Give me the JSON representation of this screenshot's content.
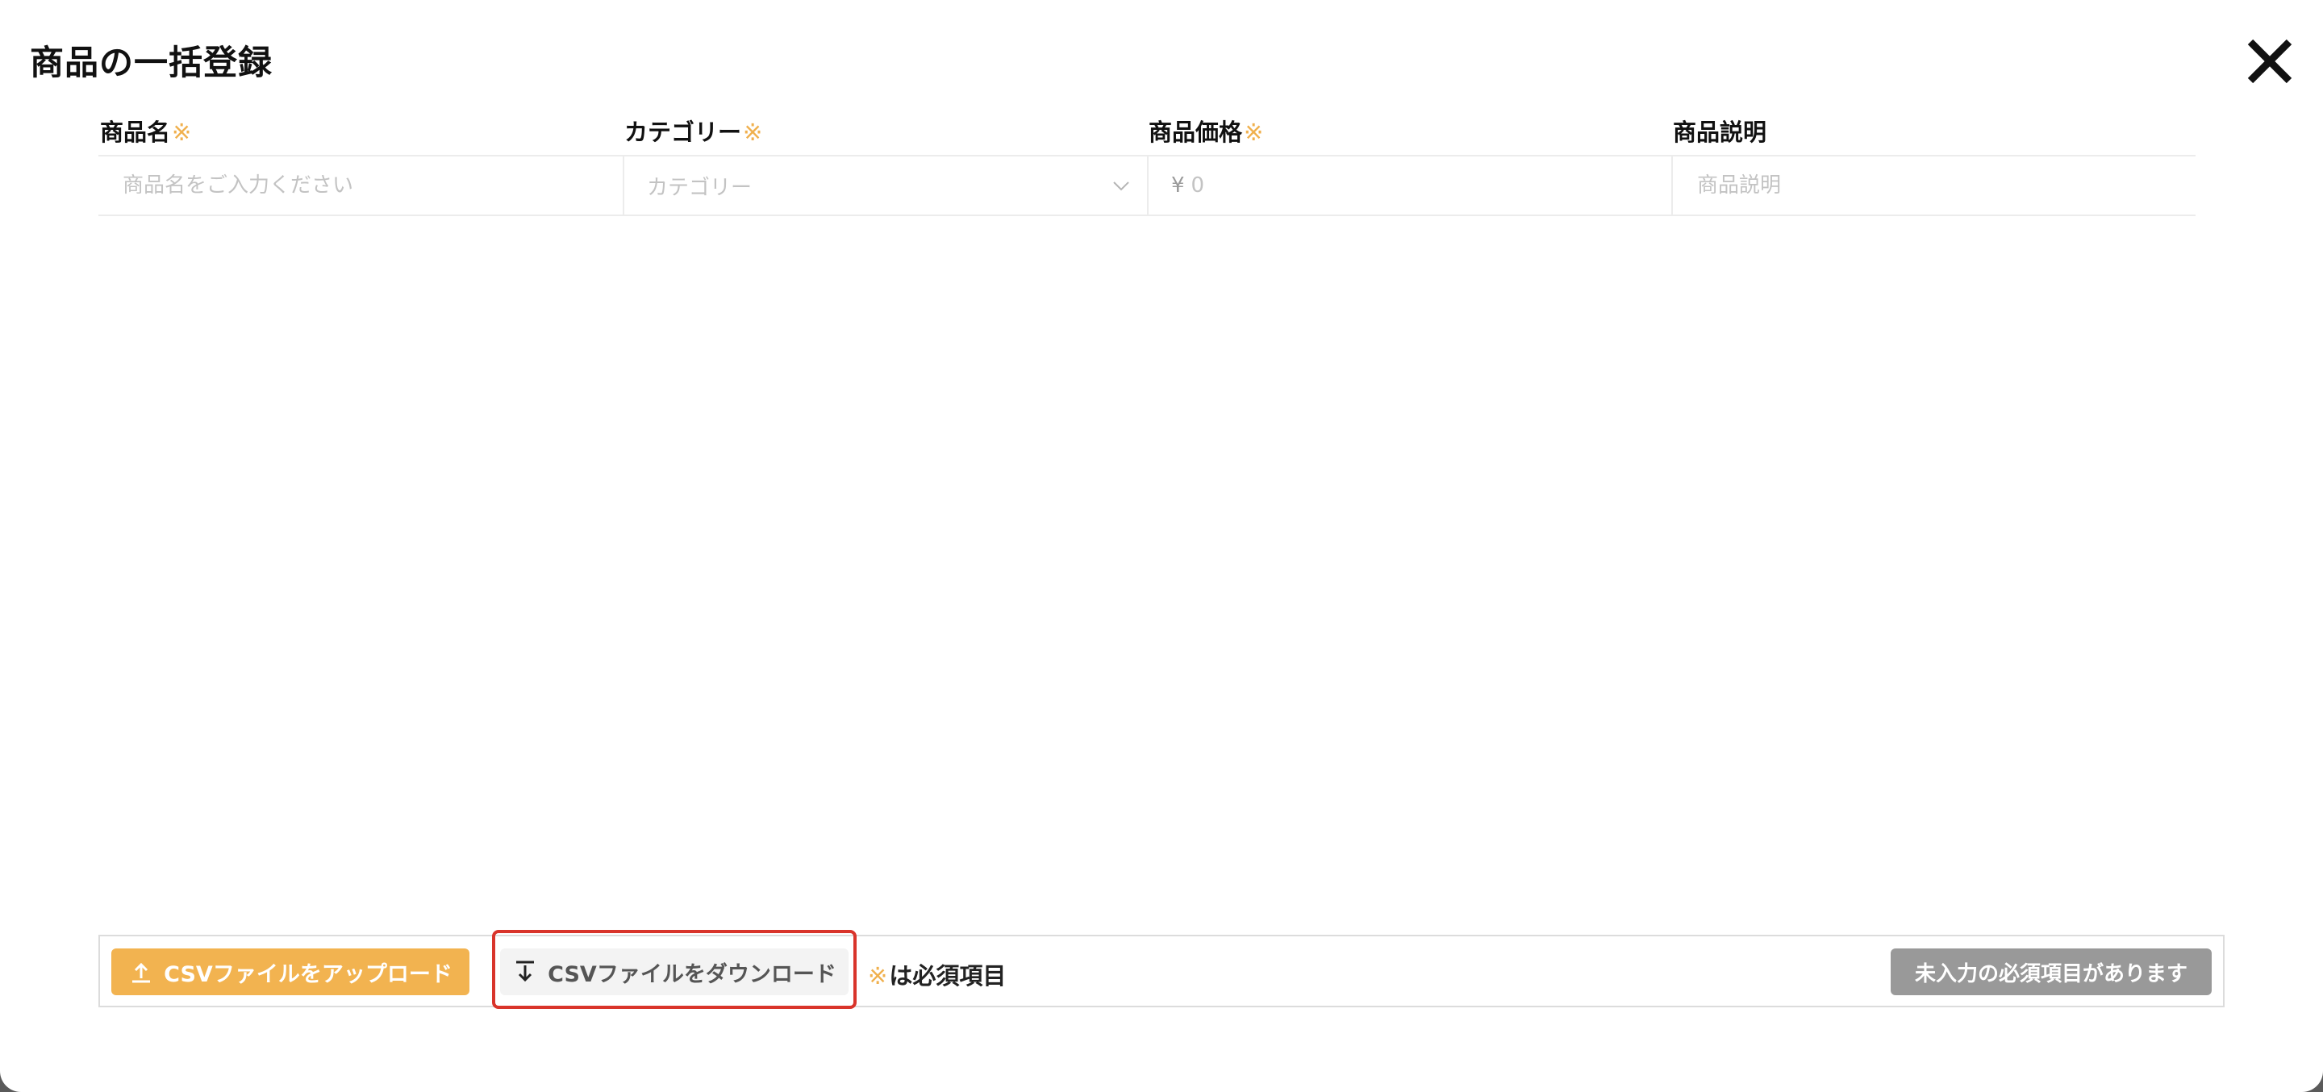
{
  "modal": {
    "title": "商品の一括登録"
  },
  "form": {
    "required_mark": "※",
    "columns": [
      {
        "label": "商品名",
        "required": true,
        "placeholder": "商品名をご入力ください"
      },
      {
        "label": "カテゴリー",
        "required": true,
        "placeholder": "カテゴリー"
      },
      {
        "label": "商品価格",
        "required": true,
        "placeholder": "0",
        "prefix": "¥"
      },
      {
        "label": "商品説明",
        "required": false,
        "placeholder": "商品説明"
      }
    ]
  },
  "footer": {
    "upload_label": "CSVファイルをアップロード",
    "download_label": "CSVファイルをダウンロード",
    "note_mark": "※",
    "note_text": "は必須項目",
    "submit_label": "未入力の必須項目があります"
  },
  "colors": {
    "accent": "#f2b350",
    "required_mark": "#f0b04d",
    "highlight": "#d9342b",
    "disabled": "#999999"
  },
  "icons": {
    "close": "close-icon",
    "upload": "upload-icon",
    "download": "download-icon",
    "chevron": "chevron-down-icon"
  }
}
